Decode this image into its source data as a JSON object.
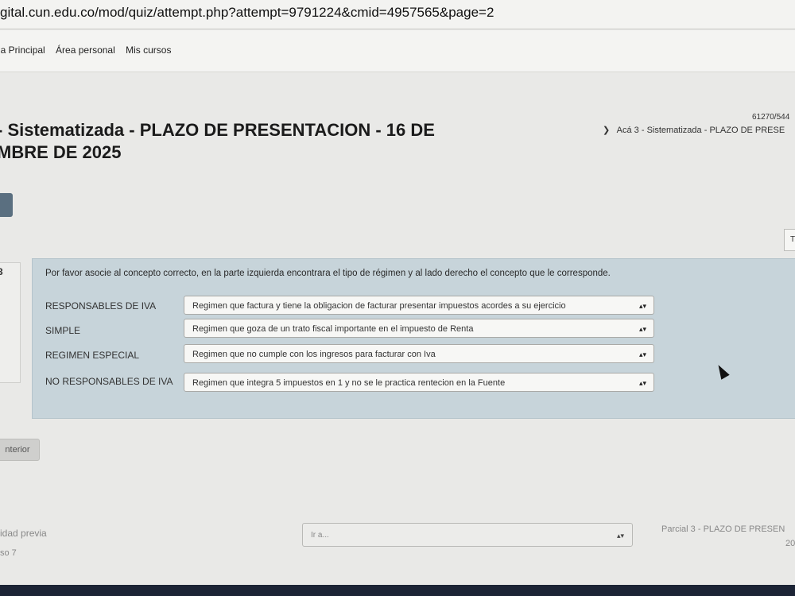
{
  "browser": {
    "url": "gital.cun.edu.co/mod/quiz/attempt.php?attempt=9791224&cmid=4957565&page=2"
  },
  "nav": {
    "links": [
      "ha Principal",
      "Área personal",
      "Mis cursos"
    ]
  },
  "page": {
    "title_line1": "- Sistematizada - PLAZO DE PRESENTACION - 16 DE",
    "title_line2": "MBRE DE 2025",
    "breadcrumb": "Acá 3 - Sistematizada - PLAZO DE PRESE",
    "course_id": "61270/544",
    "side_number": "3",
    "right_button_label": "T"
  },
  "question": {
    "prompt": "Por favor asocie al concepto correcto, en la parte izquierda encontrara el tipo de régimen  y al lado derecho el concepto que le corresponde.",
    "rows": [
      {
        "label": "RESPONSABLES DE IVA",
        "selected": "Regimen que factura y tiene la obligacion de facturar presentar impuestos acordes a su ejercicio"
      },
      {
        "label": "SIMPLE",
        "selected": "Regimen que goza de un trato fiscal importante en el impuesto de Renta"
      },
      {
        "label": "REGIMEN ESPECIAL",
        "selected": "Regimen que no cumple con los ingresos para facturar con Iva"
      },
      {
        "label": "NO RESPONSABLES DE IVA",
        "selected": "Regimen que integra 5 impuestos en 1 y no se le practica rentecion en la Fuente"
      }
    ]
  },
  "footer": {
    "prev_button": "nterior",
    "prev_activity": "idad previa",
    "prev_activity_sub": "so 7",
    "jump_placeholder": "Ir a...",
    "next_activity": "Parcial 3 - PLAZO DE PRESEN",
    "next_activity_sub": "20"
  }
}
